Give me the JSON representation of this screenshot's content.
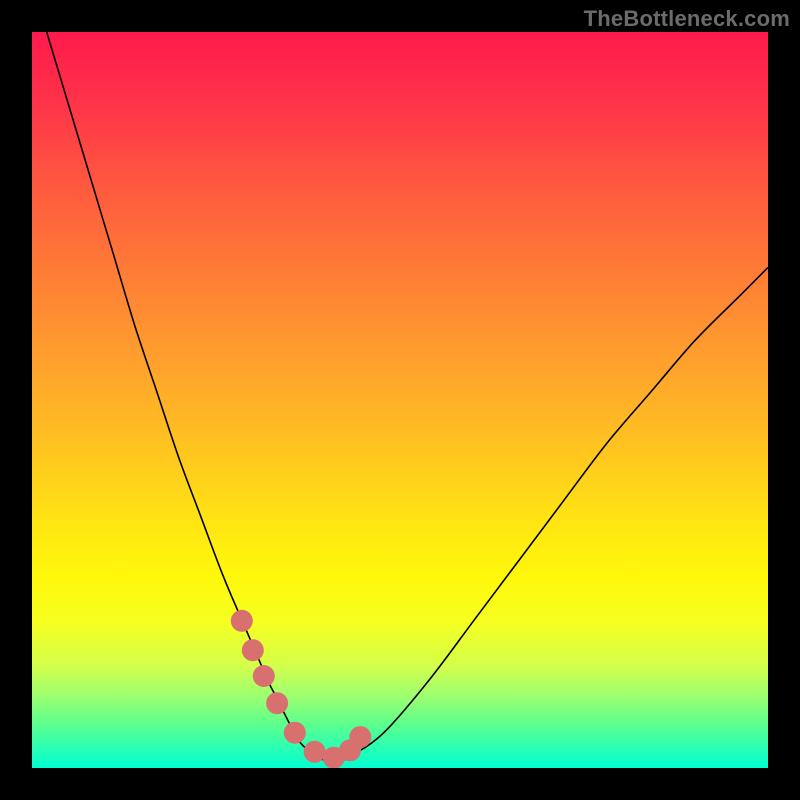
{
  "watermark": "TheBottleneck.com",
  "colors": {
    "frame": "#000000",
    "dot": "#d8706f",
    "curve": "#000000",
    "gradient_top": "#ff1a4d",
    "gradient_bottom": "#00ffd0"
  },
  "chart_data": {
    "type": "line",
    "title": "",
    "xlabel": "",
    "ylabel": "",
    "xlim": [
      0,
      100
    ],
    "ylim": [
      0,
      100
    ],
    "series": [
      {
        "name": "bottleneck-curve",
        "x": [
          2,
          5,
          8,
          11,
          14,
          17,
          20,
          23,
          26,
          29,
          32,
          33,
          34,
          35,
          36,
          38,
          40,
          42,
          44,
          48,
          54,
          60,
          66,
          72,
          78,
          84,
          90,
          96,
          100
        ],
        "y": [
          100,
          90,
          80,
          70,
          60,
          51,
          42,
          34,
          26,
          19,
          12,
          10,
          8,
          6,
          4,
          2,
          1,
          1,
          2,
          5,
          12,
          20,
          28,
          36,
          44,
          51,
          58,
          64,
          68
        ]
      }
    ],
    "highlight_points": {
      "name": "highlighted-range",
      "x": [
        28.5,
        30.0,
        31.5,
        33.3,
        35.7,
        38.4,
        41.0,
        43.2,
        44.6
      ],
      "y": [
        20.0,
        16.0,
        12.5,
        8.8,
        4.8,
        2.2,
        1.4,
        2.4,
        4.2
      ]
    }
  }
}
